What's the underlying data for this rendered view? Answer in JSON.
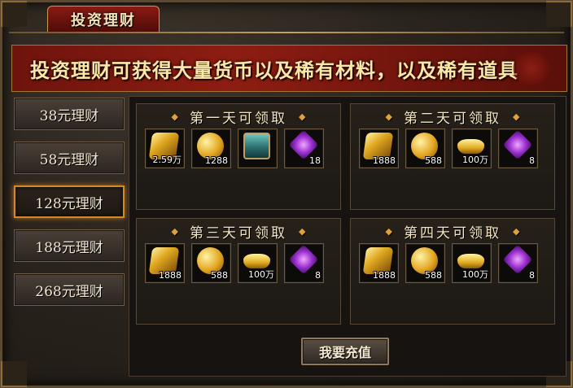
{
  "window": {
    "title": "投资理财",
    "close_glyph": "✕"
  },
  "banner": {
    "text": "投资理财可获得大量货币以及稀有材料，以及稀有道具"
  },
  "sidebar": {
    "items": [
      {
        "label": "38元理财",
        "active": false
      },
      {
        "label": "58元理财",
        "active": false
      },
      {
        "label": "128元理财",
        "active": true
      },
      {
        "label": "188元理财",
        "active": false
      },
      {
        "label": "268元理财",
        "active": false
      }
    ]
  },
  "days": [
    {
      "title": "第一天可领取",
      "items": [
        {
          "icon": "gold-scroll-icon",
          "qty": "2.59万"
        },
        {
          "icon": "gold-coin-icon",
          "qty": "1288"
        },
        {
          "icon": "treasure-chest-icon",
          "qty": ""
        },
        {
          "icon": "purple-gem-icon",
          "qty": "18"
        }
      ]
    },
    {
      "title": "第二天可领取",
      "items": [
        {
          "icon": "gold-scroll-icon",
          "qty": "1888"
        },
        {
          "icon": "gold-coin-icon",
          "qty": "588"
        },
        {
          "icon": "gold-ingot-icon",
          "qty": "100万"
        },
        {
          "icon": "purple-gem-icon",
          "qty": "8"
        }
      ]
    },
    {
      "title": "第三天可领取",
      "items": [
        {
          "icon": "gold-scroll-icon",
          "qty": "1888"
        },
        {
          "icon": "gold-coin-icon",
          "qty": "588"
        },
        {
          "icon": "gold-ingot-icon",
          "qty": "100万"
        },
        {
          "icon": "purple-gem-icon",
          "qty": "8"
        }
      ]
    },
    {
      "title": "第四天可领取",
      "items": [
        {
          "icon": "gold-scroll-icon",
          "qty": "1888"
        },
        {
          "icon": "gold-coin-icon",
          "qty": "588"
        },
        {
          "icon": "gold-ingot-icon",
          "qty": "100万"
        },
        {
          "icon": "purple-gem-icon",
          "qty": "8"
        }
      ]
    }
  ],
  "recharge_button": {
    "label": "我要充值"
  },
  "colors": {
    "accent_gold": "#e0a13a",
    "banner_red": "#8d1d12",
    "active_border": "#d08a2a"
  }
}
